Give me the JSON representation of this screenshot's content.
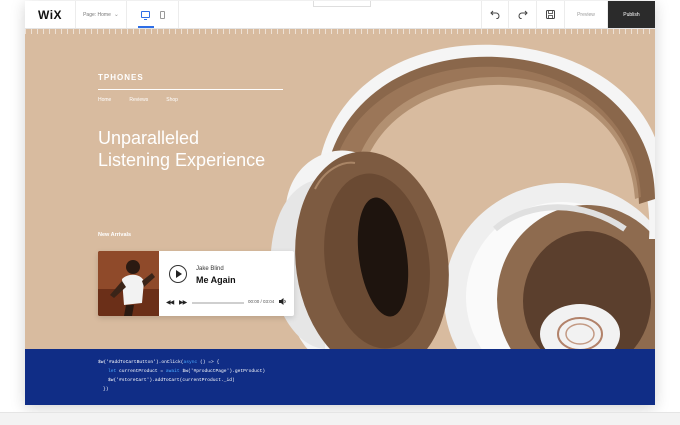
{
  "topbar": {
    "logo": "WiX",
    "page_label": "Page: Home",
    "preview_label": "Preview",
    "publish_label": "Publish",
    "icons": [
      "chevron-down-icon",
      "desktop-icon",
      "mobile-icon",
      "undo-icon",
      "redo-icon",
      "save-icon"
    ]
  },
  "site": {
    "brand": "TPHONES",
    "nav": [
      "Home",
      "Reviews",
      "Shop"
    ],
    "headline_line1": "Unparalleled",
    "headline_line2": "Listening Experience",
    "section_label": "New Arrivals",
    "background_color": "#d8bb9f"
  },
  "player": {
    "artist": "Jake Blind",
    "track": "Me Again",
    "time": "00:00 / 03:04",
    "progress": 0
  },
  "code": {
    "line1_start": "$w('#addToCartButton').onClick(",
    "line1_keyword": "async",
    "line1_end": " () => {",
    "line2_keyword1": "let",
    "line2_mid": " currentProduct = ",
    "line2_keyword2": "await",
    "line2_end": " $w('#productPage').getProduct)",
    "line3": "$w('#storeCart').addToCart(currentProduct._id)",
    "line4": "})",
    "keyword_color": "#4aa8ff",
    "string_color": "#ff6b9a",
    "background_color": "#102d86"
  }
}
